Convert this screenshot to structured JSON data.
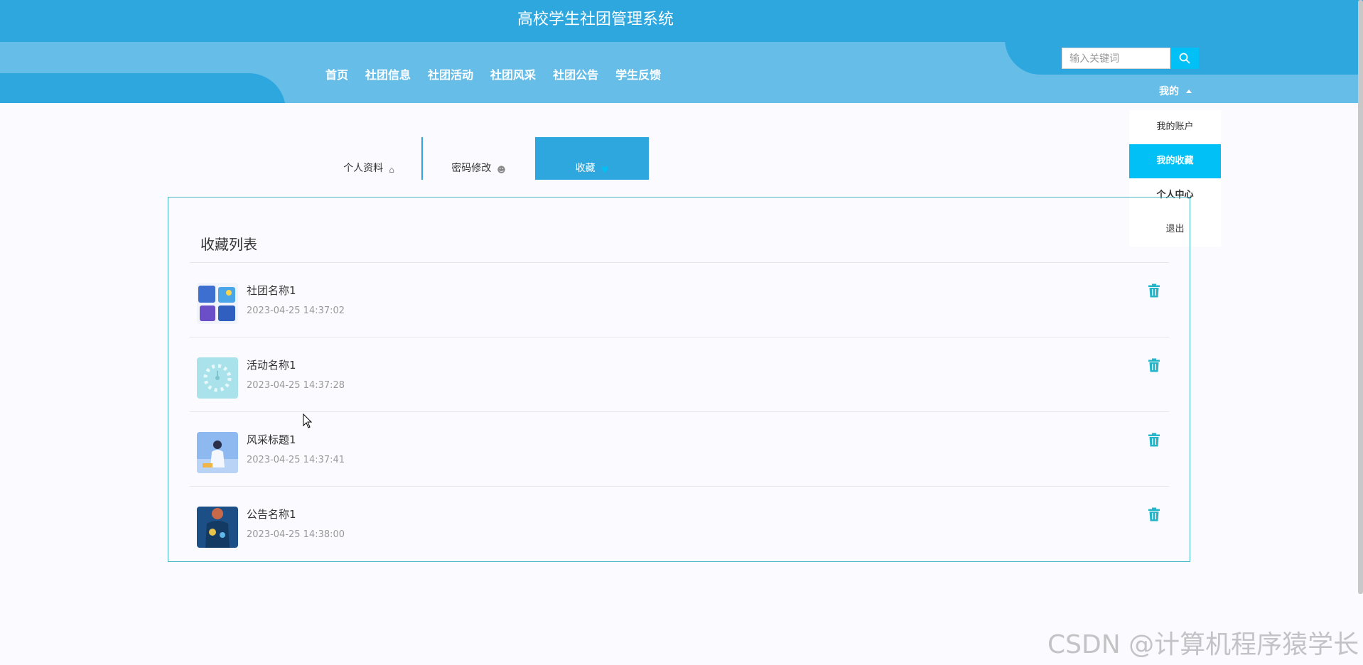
{
  "header": {
    "title": "高校学生社团管理系统",
    "nav": [
      "首页",
      "社团信息",
      "社团活动",
      "社团风采",
      "社团公告",
      "学生反馈"
    ],
    "search_placeholder": "输入关键词",
    "user_menu_label": "我的",
    "dropdown": [
      "我的账户",
      "我的收藏",
      "个人中心",
      "退出"
    ]
  },
  "tabs": {
    "profile": "个人资料",
    "password": "密码修改",
    "favorites": "收藏"
  },
  "favorites": {
    "title": "收藏列表",
    "items": [
      {
        "name": "社团名称1",
        "time": "2023-04-25 14:37:02"
      },
      {
        "name": "活动名称1",
        "time": "2023-04-25 14:37:28"
      },
      {
        "name": "风采标题1",
        "time": "2023-04-25 14:37:41"
      },
      {
        "name": "公告名称1",
        "time": "2023-04-25 14:38:00"
      }
    ]
  },
  "watermark": "CSDN @计算机程序猿学长",
  "colors": {
    "header": "#2ea7df",
    "navbar": "#66bee8",
    "accent": "#00c0f5",
    "panel_border": "#4bb7c9",
    "delete_icon": "#25b4c8"
  }
}
